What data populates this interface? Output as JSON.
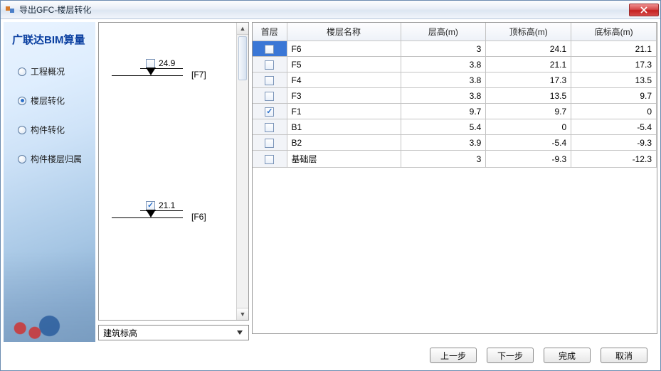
{
  "window": {
    "title": "导出GFC-楼层转化"
  },
  "sidebar": {
    "title": "广联达BIM算量",
    "items": [
      {
        "label": "工程概况",
        "selected": false
      },
      {
        "label": "楼层转化",
        "selected": true
      },
      {
        "label": "构件转化",
        "selected": false
      },
      {
        "label": "构件楼层归属",
        "selected": false
      }
    ]
  },
  "diagram": {
    "levels": [
      {
        "value": "24.9",
        "name": "[F7]",
        "checked": false
      },
      {
        "value": "21.1",
        "name": "[F6]",
        "checked": true
      }
    ]
  },
  "dropdown": {
    "selected": "建筑标高"
  },
  "table": {
    "headers": [
      "首层",
      "楼层名称",
      "层高(m)",
      "顶标高(m)",
      "底标高(m)"
    ],
    "rows": [
      {
        "checked": false,
        "name": "F6",
        "height": "3",
        "top": "24.1",
        "bottom": "21.1",
        "selected": true
      },
      {
        "checked": false,
        "name": "F5",
        "height": "3.8",
        "top": "21.1",
        "bottom": "17.3",
        "selected": false
      },
      {
        "checked": false,
        "name": "F4",
        "height": "3.8",
        "top": "17.3",
        "bottom": "13.5",
        "selected": false
      },
      {
        "checked": false,
        "name": "F3",
        "height": "3.8",
        "top": "13.5",
        "bottom": "9.7",
        "selected": false
      },
      {
        "checked": true,
        "name": "F1",
        "height": "9.7",
        "top": "9.7",
        "bottom": "0",
        "selected": false
      },
      {
        "checked": false,
        "name": "B1",
        "height": "5.4",
        "top": "0",
        "bottom": "-5.4",
        "selected": false
      },
      {
        "checked": false,
        "name": "B2",
        "height": "3.9",
        "top": "-5.4",
        "bottom": "-9.3",
        "selected": false
      },
      {
        "checked": false,
        "name": "基础层",
        "height": "3",
        "top": "-9.3",
        "bottom": "-12.3",
        "selected": false
      }
    ]
  },
  "footer": {
    "prev": "上一步",
    "next": "下一步",
    "finish": "完成",
    "cancel": "取消"
  }
}
